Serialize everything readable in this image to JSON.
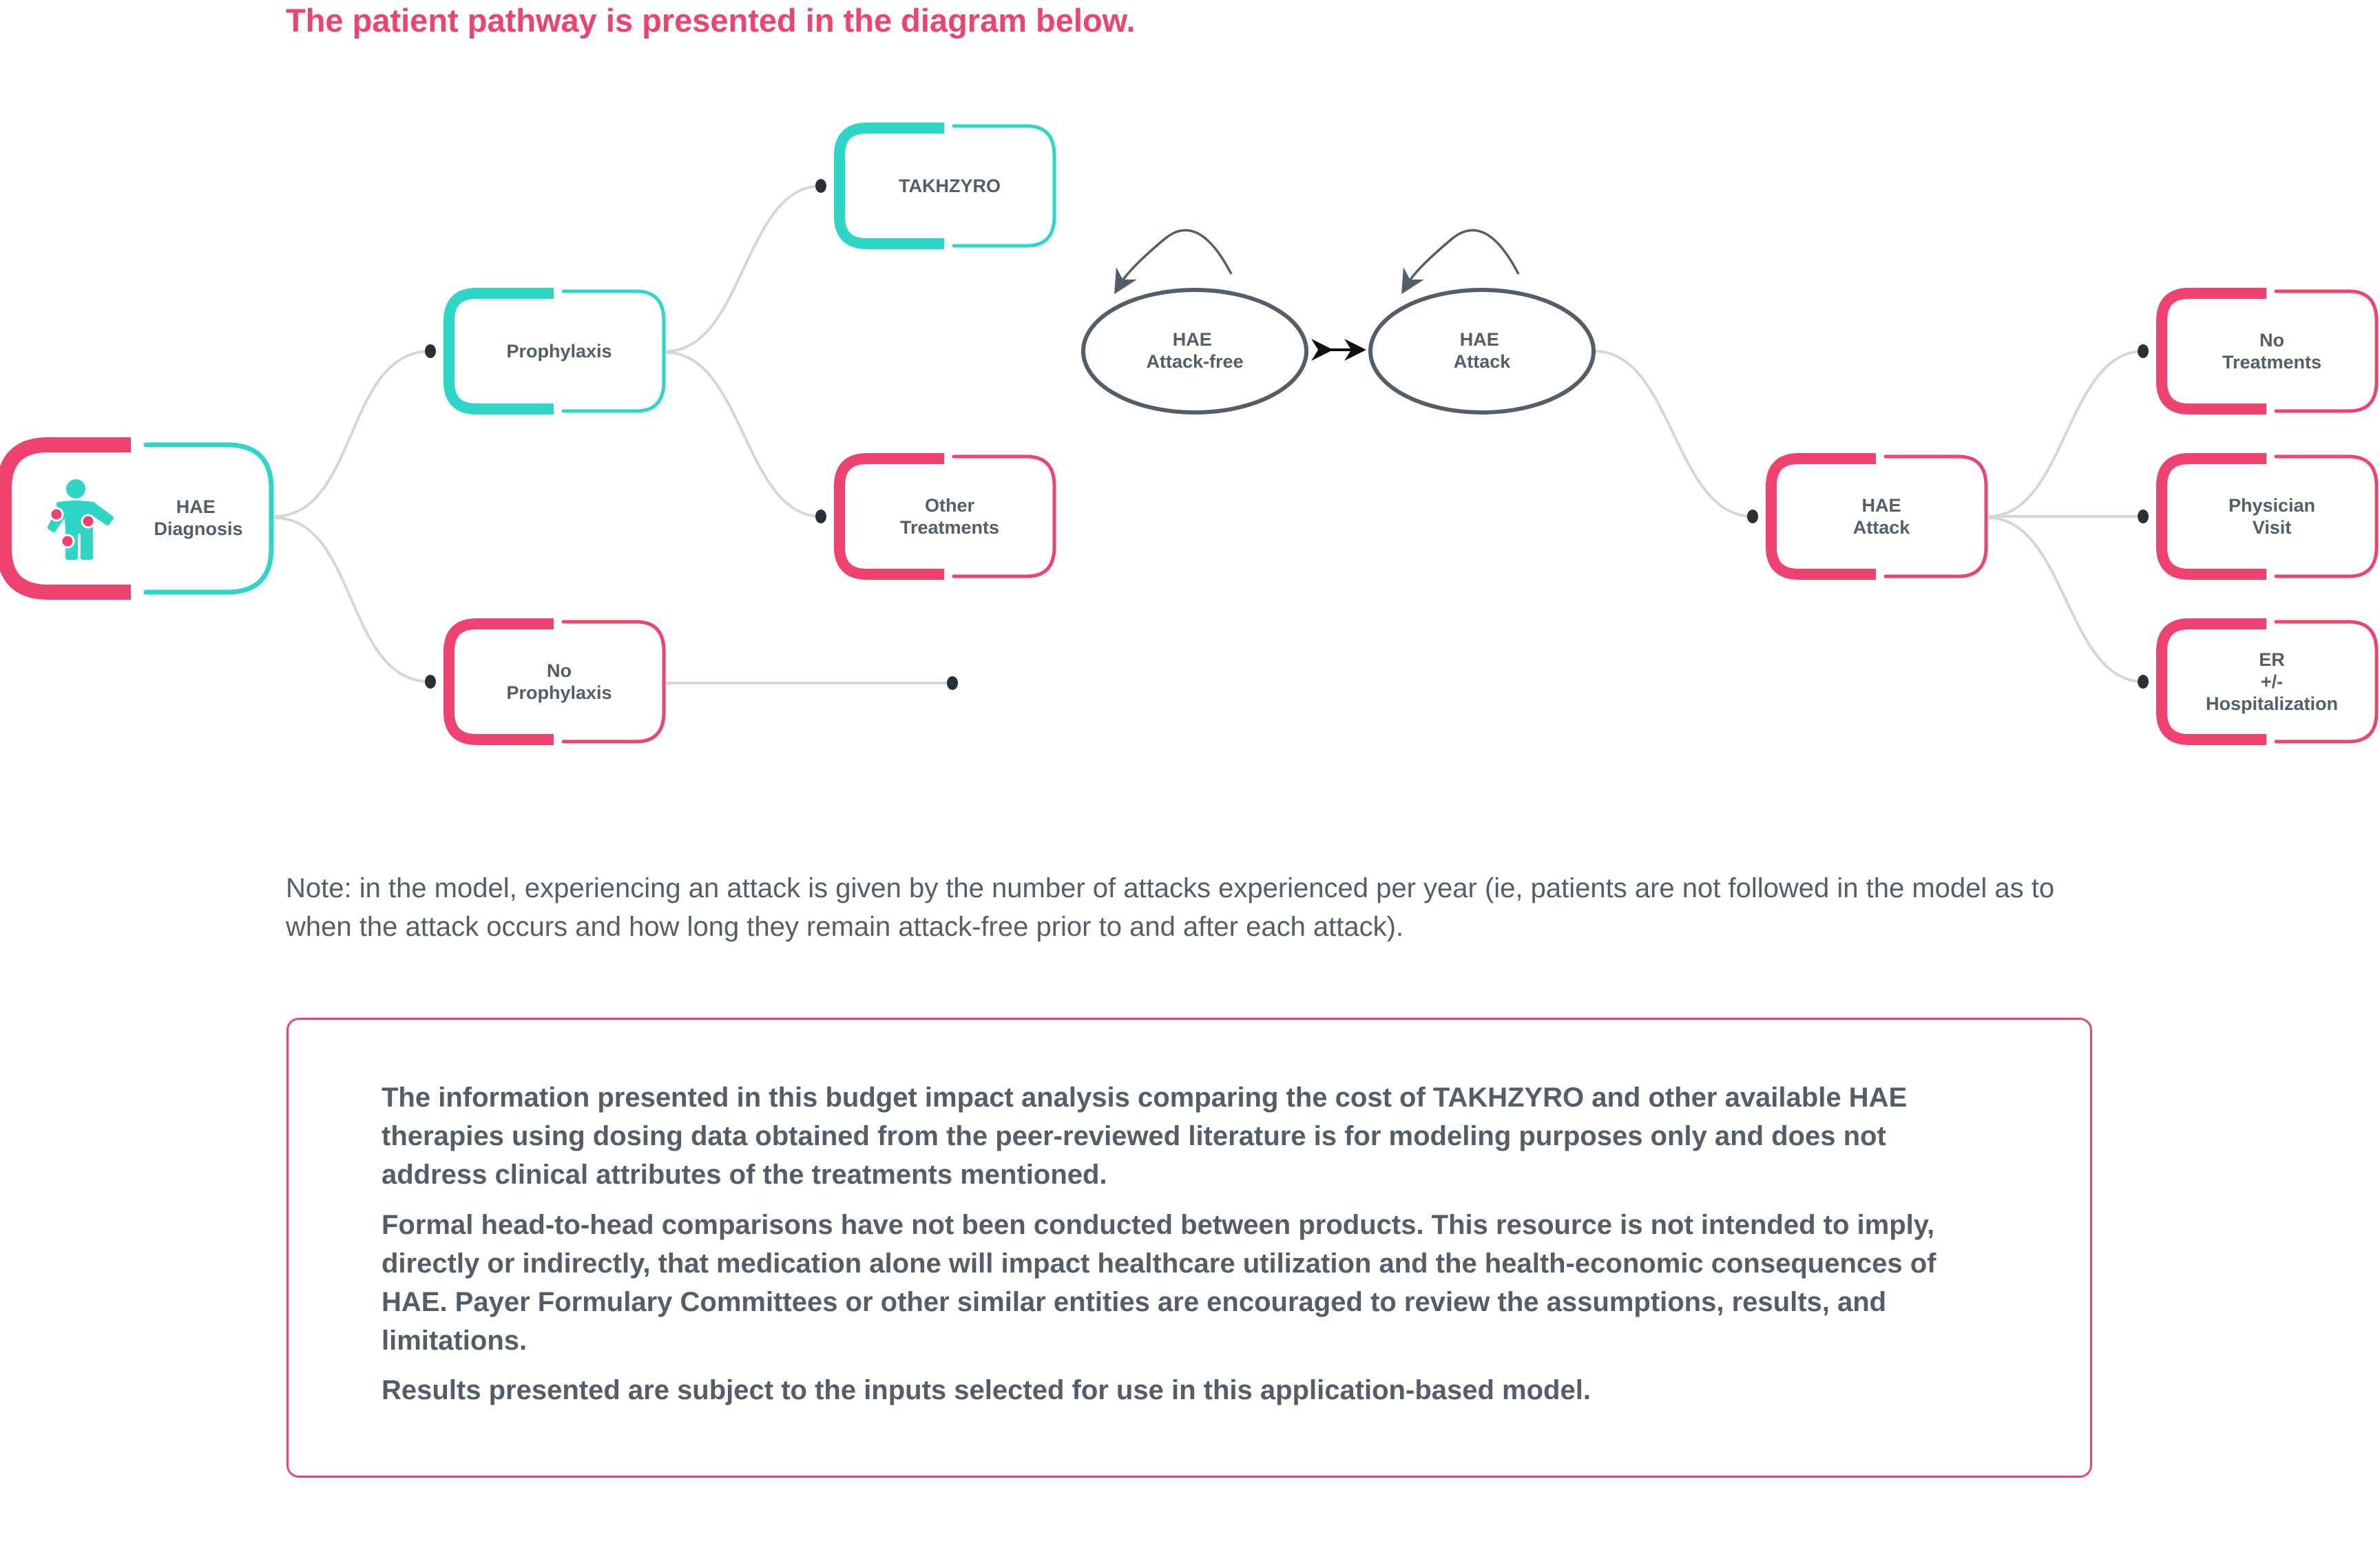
{
  "title": "The patient pathway is presented in the diagram below.",
  "colors": {
    "pink": "#EF426F",
    "teal": "#2ED6C6",
    "text": "#545E69",
    "connector": "#D3D6DA",
    "dot": "#2B2F36",
    "ellipse": "#545E69"
  },
  "diagram": {
    "nodes": {
      "diagnosis": {
        "lines": [
          "HAE",
          "Diagnosis"
        ],
        "icon": "patient-figure-icon"
      },
      "prophylaxis": {
        "lines": [
          "Prophylaxis"
        ]
      },
      "no_prophylaxis": {
        "lines": [
          "No",
          "Prophylaxis"
        ]
      },
      "takhzyro": {
        "lines": [
          "TAKHZYRO"
        ]
      },
      "other_treatments": {
        "lines": [
          "Other",
          "Treatments"
        ]
      },
      "attack_free": {
        "lines": [
          "HAE",
          "Attack-free"
        ]
      },
      "attack_state": {
        "lines": [
          "HAE",
          "Attack"
        ]
      },
      "hae_attack": {
        "lines": [
          "HAE",
          "Attack"
        ]
      },
      "no_treatments": {
        "lines": [
          "No",
          "Treatments"
        ]
      },
      "physician_visit": {
        "lines": [
          "Physician",
          "Visit"
        ]
      },
      "er_hospitalization": {
        "lines": [
          "ER",
          "+/-",
          "Hospitalization"
        ]
      }
    }
  },
  "note": "Note: in the model, experiencing an attack is given by the number of attacks experienced per year (ie, patients are not followed in the model as to when the attack occurs and how long they remain attack-free prior to and after each attack).",
  "disclaimer": {
    "paragraphs": [
      "The information presented in this budget impact analysis comparing the cost of TAKHZYRO and other available HAE therapies using dosing data obtained from the peer-reviewed literature is for modeling purposes only and does not address clinical attributes of the treatments mentioned.",
      "Formal head-to-head comparisons have not been conducted between products. This resource is not intended to imply, directly or indirectly, that medication alone will impact healthcare utilization and the health-economic consequences of HAE. Payer Formulary Committees or other similar entities are encouraged to review the assumptions, results, and limitations.",
      "Results presented are subject to the inputs selected for use in this application-based model."
    ]
  }
}
